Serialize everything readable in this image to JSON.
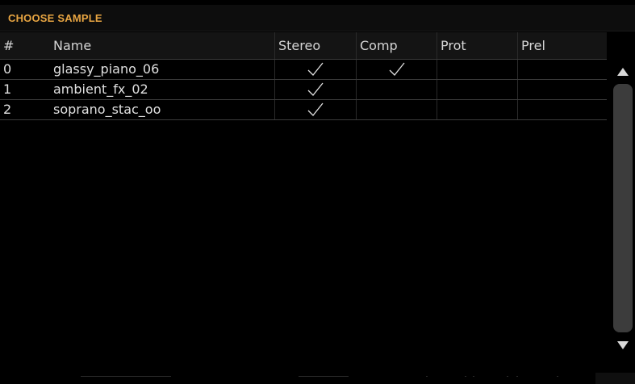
{
  "dialog": {
    "title": "CHOOSE SAMPLE"
  },
  "table": {
    "columns": [
      "#",
      "Name",
      "Stereo",
      "Comp",
      "Prot",
      "Prel"
    ],
    "rows": [
      {
        "index": "0",
        "name": "glassy_piano_06",
        "stereo": true,
        "comp": true,
        "prot": false,
        "prel": false
      },
      {
        "index": "1",
        "name": "ambient_fx_02",
        "stereo": true,
        "comp": false,
        "prot": false,
        "prel": false
      },
      {
        "index": "2",
        "name": "soprano_stac_oo",
        "stereo": true,
        "comp": false,
        "prot": false,
        "prel": false
      }
    ]
  },
  "scrollbar": {
    "up_icon": "triangle-up-icon",
    "down_icon": "triangle-down-icon"
  },
  "colors": {
    "title": "#e8a542",
    "background": "#000000",
    "row_text": "#e0e0e0",
    "divider": "#3a3a3a",
    "scroll_track": "#3c3c3c"
  }
}
